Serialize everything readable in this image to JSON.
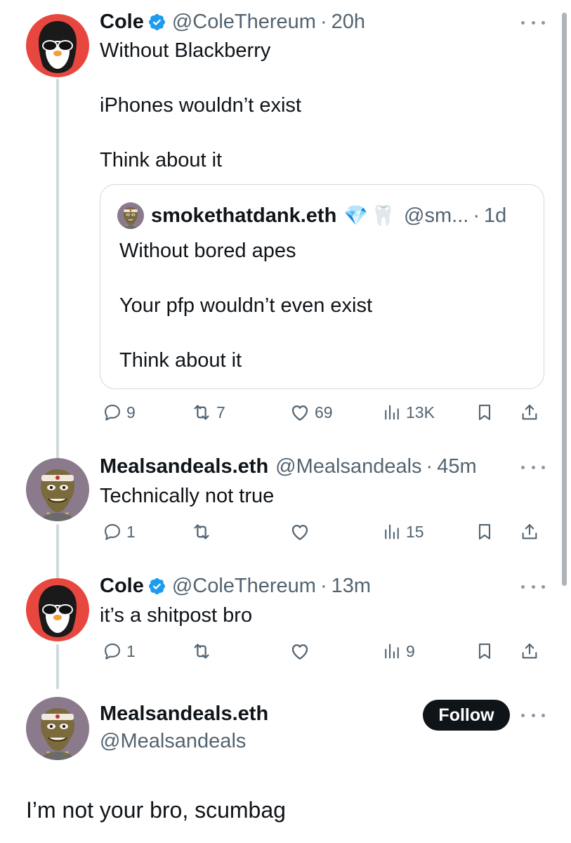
{
  "tweets": [
    {
      "name": "Cole",
      "handle": "@ColeThereum",
      "time": "20h",
      "verified": true,
      "avatar_icon": "penguin-avatar",
      "text": "Without Blackberry\n\niPhones wouldn’t exist\n\nThink about it",
      "quote": {
        "name": "smokethatdank.eth",
        "badges": [
          "💎",
          "🦷"
        ],
        "handle": "@sm...",
        "time": "1d",
        "avatar_icon": "ape-avatar",
        "text": "Without bored apes\n\nYour pfp wouldn’t even exist\n\nThink about it"
      },
      "stats": {
        "replies": "9",
        "retweets": "7",
        "likes": "69",
        "views": "13K"
      }
    },
    {
      "name": "Mealsandeals.eth",
      "handle": "@Mealsandeals",
      "time": "45m",
      "verified": false,
      "avatar_icon": "ape-avatar",
      "text": "Technically not true",
      "stats": {
        "replies": "1",
        "retweets": "",
        "likes": "",
        "views": "15"
      }
    },
    {
      "name": "Cole",
      "handle": "@ColeThereum",
      "time": "13m",
      "verified": true,
      "avatar_icon": "penguin-avatar",
      "text": "it’s a shitpost bro",
      "stats": {
        "replies": "1",
        "retweets": "",
        "likes": "",
        "views": "9"
      }
    }
  ],
  "main_tweet": {
    "name": "Mealsandeals.eth",
    "handle": "@Mealsandeals",
    "follow_label": "Follow",
    "avatar_icon": "ape-avatar",
    "text": "I’m not your bro, scumbag"
  },
  "separator": "·",
  "colors": {
    "text": "#0f1419",
    "secondary": "#536471",
    "verified_blue": "#1d9bf0",
    "thread_line": "#cfd9de",
    "follow_bg": "#0f1419"
  }
}
